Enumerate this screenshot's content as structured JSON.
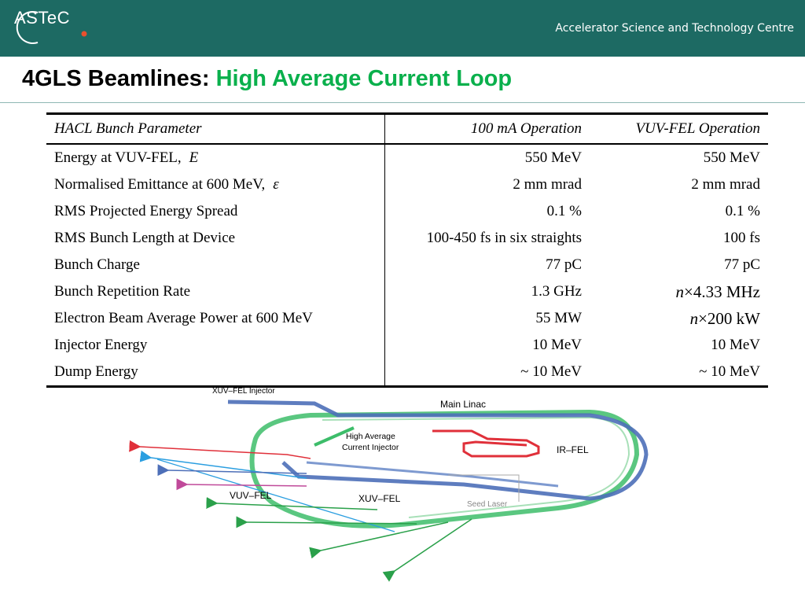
{
  "header": {
    "logo_text": "ASTeC",
    "organization": "Accelerator Science and Technology Centre",
    "bg_color": "#1d6a63"
  },
  "slide": {
    "title_main": "4GLS Beamlines:",
    "title_highlight": "High Average Current Loop",
    "highlight_color": "#0ab04c"
  },
  "table": {
    "headers": [
      "HACL Bunch Parameter",
      "100 mA Operation",
      "VUV-FEL Operation"
    ],
    "rows": [
      {
        "param": "Energy at VUV-FEL,",
        "symbol": "E",
        "op100": "550 MeV",
        "vuv": "550 MeV"
      },
      {
        "param": "Normalised Emittance at 600 MeV,",
        "symbol": "ε",
        "op100": "2 mm mrad",
        "vuv": "2 mm mrad"
      },
      {
        "param": "RMS Projected Energy Spread",
        "symbol": "",
        "op100": "0.1 %",
        "vuv": "0.1 %"
      },
      {
        "param": "RMS Bunch Length at Device",
        "symbol": "",
        "op100": "100-450 fs in six straights",
        "vuv": "100 fs"
      },
      {
        "param": "Bunch Charge",
        "symbol": "",
        "op100": "77 pC",
        "vuv": "77 pC"
      },
      {
        "param": "Bunch Repetition Rate",
        "symbol": "",
        "op100": "1.3 GHz",
        "vuv_n": "n",
        "vuv": "×4.33 MHz"
      },
      {
        "param": "Electron Beam Average Power at 600 MeV",
        "symbol": "",
        "op100": "55 MW",
        "vuv_n": "n",
        "vuv": "×200 kW"
      },
      {
        "param": "Injector Energy",
        "symbol": "",
        "op100": "10 MeV",
        "vuv": "10 MeV"
      },
      {
        "param": "Dump Energy",
        "symbol": "",
        "op100": "~ 10 MeV",
        "vuv": "~ 10 MeV"
      }
    ]
  },
  "diagram": {
    "labels": {
      "xuv_fel_injector": "XUV–FEL Injector",
      "main_linac": "Main Linac",
      "high_avg_injector_line1": "High Average",
      "high_avg_injector_line2": "Current Injector",
      "ir_fel": "IR–FEL",
      "vuv_fel": "VUV–FEL",
      "xuv_fel": "XUV–FEL",
      "seed_laser": "Seed Laser"
    },
    "colors": {
      "green_loop": "#3dbd6a",
      "blue_loop": "#4d6fb8",
      "red_line": "#e0303a",
      "light_blue": "#2a9ee0",
      "purple": "#c04a9a"
    }
  }
}
